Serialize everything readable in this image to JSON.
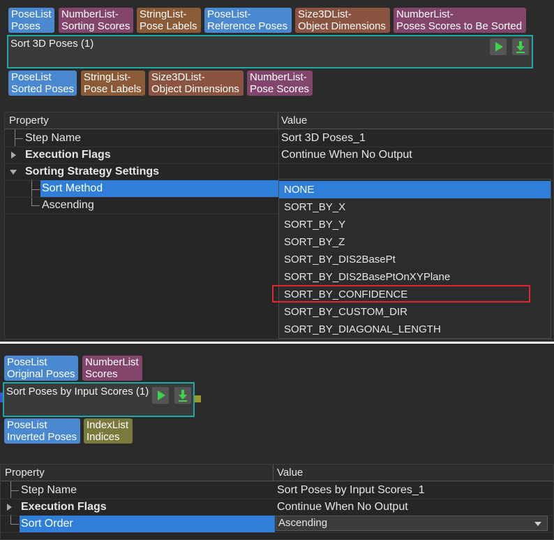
{
  "top_step": {
    "title": "Sort 3D Poses (1)",
    "inputs": [
      {
        "type": "PoseList",
        "name": "Poses"
      },
      {
        "type": "NumberList-",
        "name": "Sorting Scores"
      },
      {
        "type": "StringList-",
        "name": "Pose Labels"
      },
      {
        "type": "PoseList-",
        "name": "Reference Poses"
      },
      {
        "type": "Size3DList-",
        "name": "Object Dimensions"
      },
      {
        "type": "NumberList-",
        "name": "Poses Scores to Be Sorted"
      }
    ],
    "outputs": [
      {
        "type": "PoseList",
        "name": "Sorted Poses"
      },
      {
        "type": "StringList-",
        "name": "Pose Labels"
      },
      {
        "type": "Size3DList-",
        "name": "Object Dimensions"
      },
      {
        "type": "NumberList-",
        "name": "Pose Scores"
      }
    ]
  },
  "top_props": {
    "header": {
      "property": "Property",
      "value": "Value"
    },
    "rows": [
      {
        "property": "Step Name",
        "value": "Sort 3D Poses_1"
      },
      {
        "property": "Execution Flags",
        "value": "Continue When No Output"
      },
      {
        "property": "Sorting Strategy Settings",
        "value": ""
      },
      {
        "property": "Sort Method",
        "value": ""
      },
      {
        "property": "Ascending",
        "value": ""
      }
    ],
    "dropdown": {
      "selected": "NONE",
      "highlighted": "SORT_BY_CONFIDENCE",
      "options": [
        "NONE",
        "SORT_BY_X",
        "SORT_BY_Y",
        "SORT_BY_Z",
        "SORT_BY_DIS2BasePt",
        "SORT_BY_DIS2BasePtOnXYPlane",
        "SORT_BY_CONFIDENCE",
        "SORT_BY_CUSTOM_DIR",
        "SORT_BY_DIAGONAL_LENGTH"
      ]
    }
  },
  "bottom_step": {
    "title": "Sort Poses by Input Scores (1)",
    "inputs": [
      {
        "type": "PoseList",
        "name": "Original Poses"
      },
      {
        "type": "NumberList",
        "name": "Scores"
      }
    ],
    "outputs": [
      {
        "type": "PoseList",
        "name": "Inverted Poses"
      },
      {
        "type": "IndexList",
        "name": "Indices"
      }
    ]
  },
  "bottom_props": {
    "header": {
      "property": "Property",
      "value": "Value"
    },
    "rows": [
      {
        "property": "Step Name",
        "value": "Sort Poses by Input Scores_1"
      },
      {
        "property": "Execution Flags",
        "value": "Continue When No Output"
      },
      {
        "property": "Sort Order",
        "value": "Ascending"
      }
    ]
  },
  "colors": {
    "pose": "#4a88cf",
    "number": "#83456b",
    "string": "#8b5a36",
    "size3d": "#8b5440",
    "index": "#7a7a3c",
    "step_border": "#1fa9a5",
    "selection": "#2f7fd8",
    "highlight_box": "#e0262a"
  },
  "icons": [
    "run-icon",
    "download-icon",
    "dropdown-arrow-icon",
    "expand-icon",
    "collapse-icon"
  ]
}
